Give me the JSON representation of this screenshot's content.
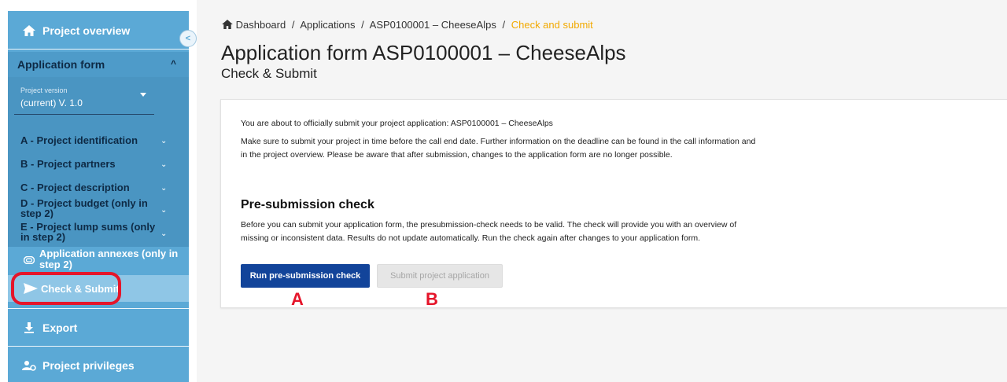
{
  "sidebar": {
    "project_overview": "Project overview",
    "application_form": "Application form",
    "version_label": "Project version",
    "version_value": "(current) V. 1.0",
    "items": [
      {
        "label": "A - Project identification"
      },
      {
        "label": "B - Project partners"
      },
      {
        "label": "C - Project description"
      },
      {
        "label": "D - Project budget (only in step 2)"
      },
      {
        "label": "E - Project lump sums (only in step 2)"
      }
    ],
    "annexes": "Application annexes (only in step 2)",
    "check_submit": "Check & Submit",
    "export": "Export",
    "privileges": "Project privileges",
    "icons": {
      "home": "home-icon",
      "collapse": "chevron-left-icon",
      "annex": "paperclip-icon",
      "send": "send-icon",
      "download": "download-icon",
      "privileges": "users-gear-icon"
    },
    "colors": {
      "sidebar": "#5ba9d6",
      "highlight": "#e5152a"
    }
  },
  "breadcrumb": {
    "items": [
      "Dashboard",
      "Applications",
      "ASP0100001 – CheeseAlps"
    ],
    "current": "Check and submit",
    "separator": "/"
  },
  "page": {
    "title": "Application form ASP0100001 – CheeseAlps",
    "subtitle": "Check & Submit"
  },
  "card": {
    "p1": "You are about to officially submit your project application: ASP0100001 – CheeseAlps",
    "p2": "Make sure to submit your project in time before the call end date. Further information on the deadline can be found in the call information and in the project overview. Please be aware that after submission, changes to the application form are no longer possible.",
    "heading": "Pre-submission check",
    "p3": "Before you can submit your application form, the presubmission-check needs to be valid. The check will provide you with an overview of missing or inconsistent data. Results do not update automatically. Run the check again after changes to your application form.",
    "run_button": "Run pre-submission check",
    "submit_button": "Submit project application",
    "annotation_a": "A",
    "annotation_b": "B",
    "colors": {
      "run_button": "#12449a",
      "current_breadcrumb": "#f2a900"
    }
  }
}
